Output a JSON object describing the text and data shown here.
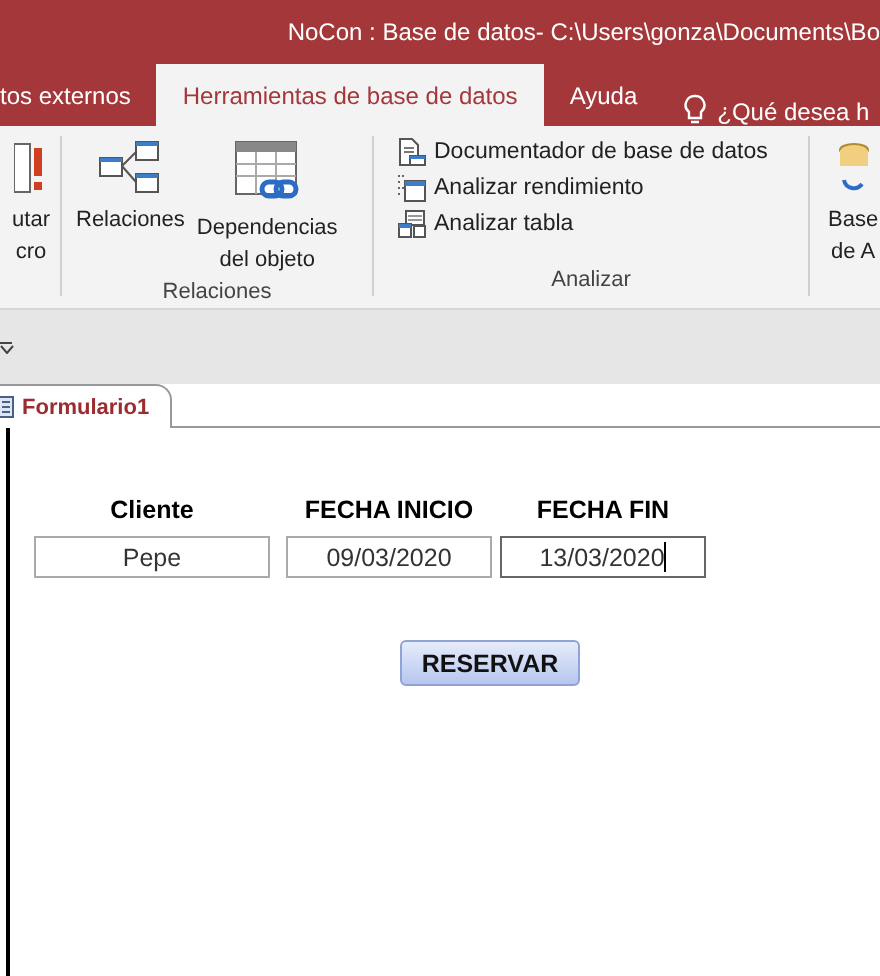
{
  "window": {
    "title": "NoCon : Base de datos- C:\\Users\\gonza\\Documents\\Bo"
  },
  "ribbon_tabs": [
    {
      "label": "tos externos",
      "selected": false
    },
    {
      "label": "Herramientas de base de datos",
      "selected": true
    },
    {
      "label": "Ayuda",
      "selected": false
    }
  ],
  "tell_me": {
    "text": "¿Qué desea h"
  },
  "ribbon": {
    "groups": [
      {
        "kind": "large",
        "buttons": [
          {
            "label": "utar\ncro"
          }
        ]
      },
      {
        "kind": "large",
        "label": "Relaciones",
        "buttons": [
          {
            "label": "Relaciones"
          },
          {
            "label": "Dependencias\ndel objeto"
          }
        ]
      },
      {
        "kind": "small",
        "label": "Analizar",
        "buttons": [
          {
            "label": "Documentador de base de datos"
          },
          {
            "label": "Analizar rendimiento"
          },
          {
            "label": "Analizar tabla"
          }
        ]
      },
      {
        "kind": "large",
        "buttons": [
          {
            "label": "Base\nde A"
          }
        ]
      }
    ]
  },
  "document_tabs": [
    {
      "label": "Formulario1",
      "selected": true
    }
  ],
  "form": {
    "fields": [
      {
        "label": "Cliente",
        "value": "Pepe",
        "focused": false
      },
      {
        "label": "FECHA INICIO",
        "value": "09/03/2020",
        "focused": false
      },
      {
        "label": "FECHA FIN",
        "value": "13/03/2020",
        "focused": true
      }
    ],
    "button": "RESERVAR"
  }
}
